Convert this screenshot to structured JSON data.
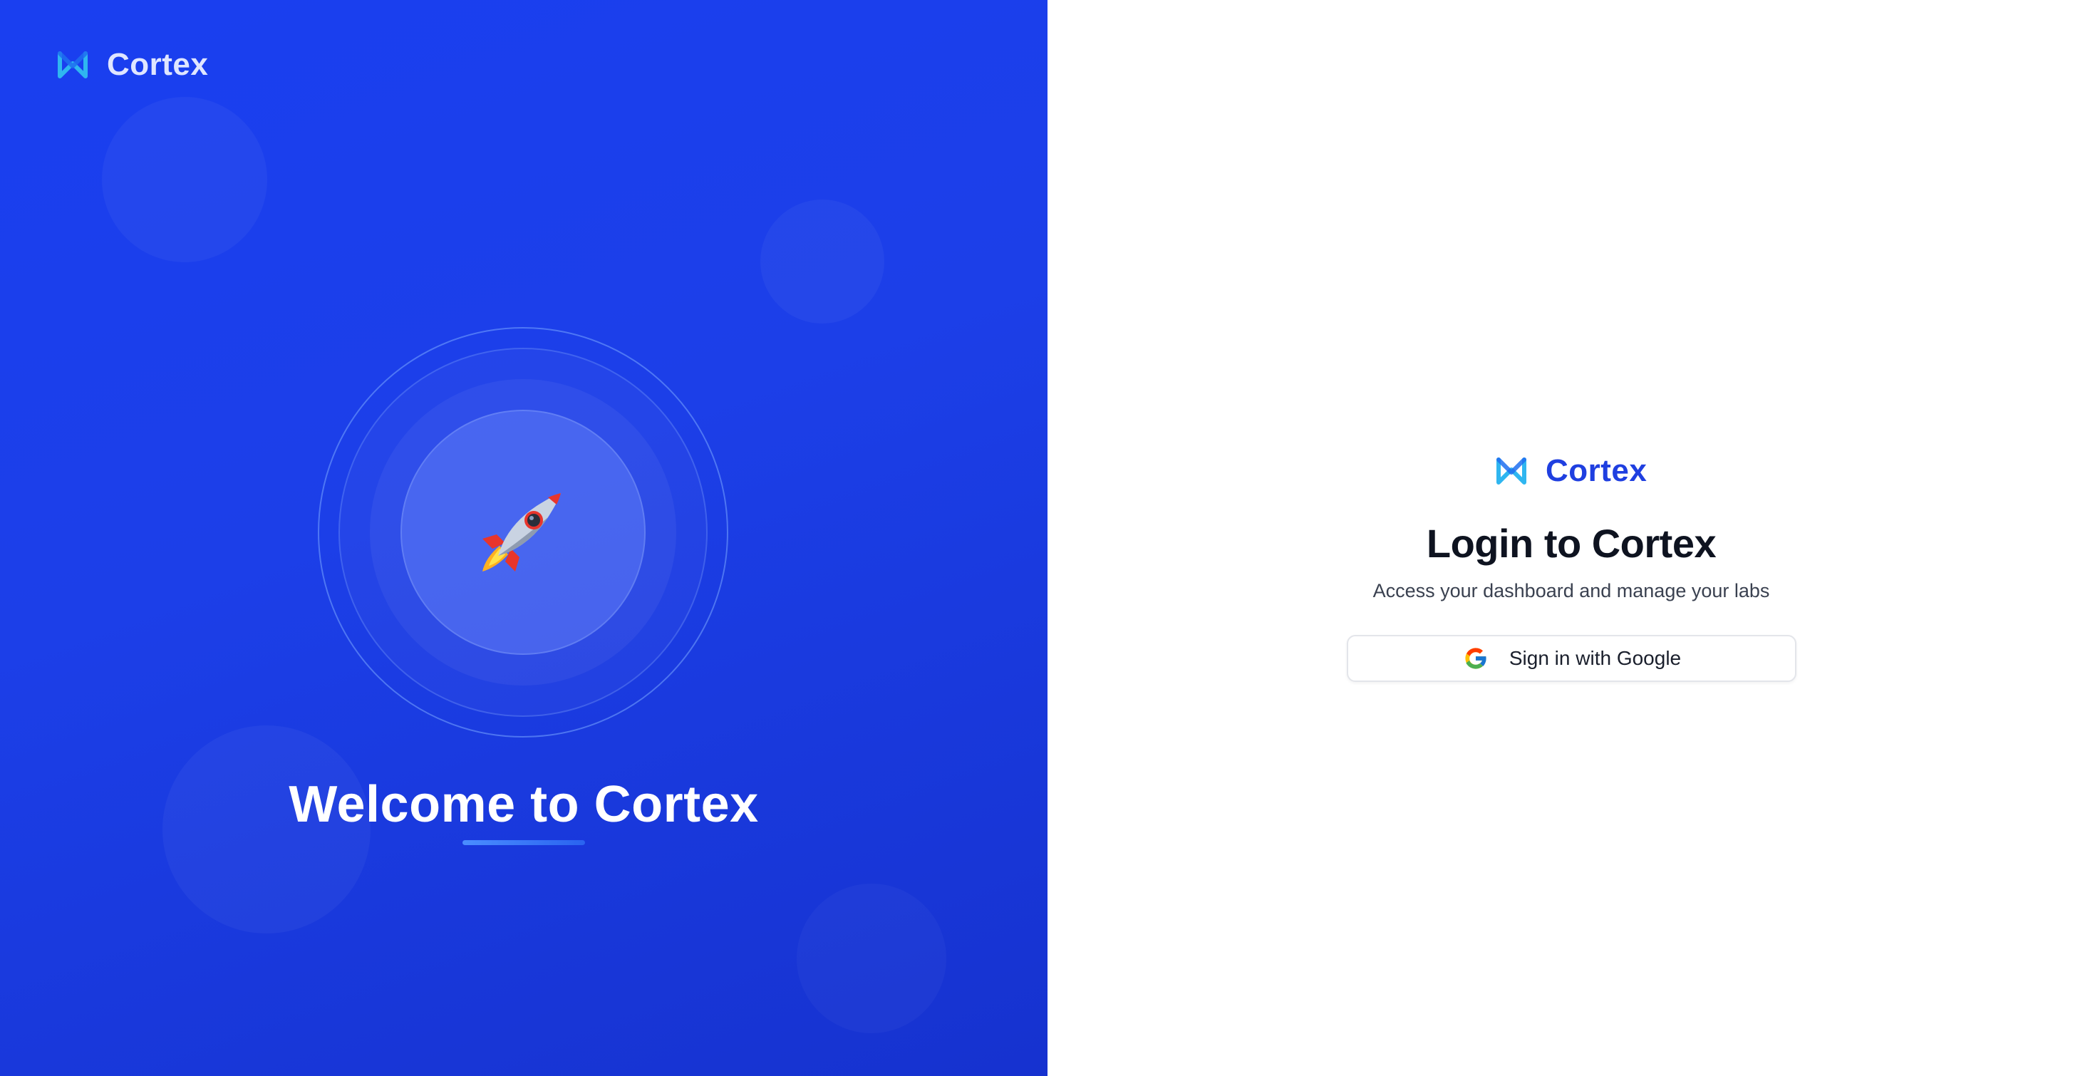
{
  "hero": {
    "brand_name": "Cortex",
    "title": "Welcome to Cortex",
    "emblem_icon": "rocket-icon"
  },
  "login": {
    "brand_name": "Cortex",
    "title": "Login to Cortex",
    "subtitle": "Access your dashboard and manage your labs",
    "google_button_label": "Sign in with Google",
    "google_icon": "google-g-icon"
  },
  "colors": {
    "hero_background": "#1a3ff0",
    "brand_accent": "#1f3fe0",
    "logo_cyan": "#2fb6f0",
    "login_background": "#ffffff"
  }
}
